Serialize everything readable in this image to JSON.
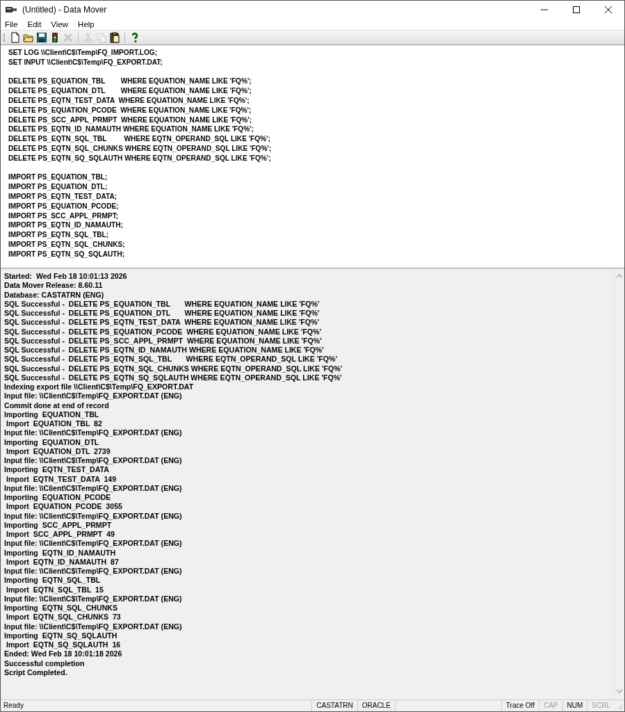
{
  "window": {
    "title": "(Untitled) - Data Mover"
  },
  "menu": [
    "File",
    "Edit",
    "View",
    "Help"
  ],
  "toolbar": [
    {
      "kind": "new",
      "disabled": false
    },
    {
      "kind": "open",
      "disabled": false
    },
    {
      "kind": "save",
      "disabled": false
    },
    {
      "kind": "run",
      "disabled": false
    },
    {
      "kind": "cancel",
      "disabled": true
    },
    {
      "kind": "sep"
    },
    {
      "kind": "cut",
      "disabled": true
    },
    {
      "kind": "copy",
      "disabled": true
    },
    {
      "kind": "paste",
      "disabled": false
    },
    {
      "kind": "sep"
    },
    {
      "kind": "help",
      "disabled": false
    }
  ],
  "editor": {
    "blocks": [
      [
        "SET LOG \\\\Client\\C$\\Temp\\FQ_IMPORT.LOG;",
        "SET INPUT \\\\Client\\C$\\Temp\\FQ_EXPORT.DAT;"
      ],
      [
        "DELETE PS_EQUATION_TBL        WHERE EQUATION_NAME LIKE 'FQ%';",
        "DELETE PS_EQUATION_DTL        WHERE EQUATION_NAME LIKE 'FQ%';",
        "DELETE PS_EQTN_TEST_DATA  WHERE EQUATION_NAME LIKE 'FQ%';",
        "DELETE PS_EQUATION_PCODE  WHERE EQUATION_NAME LIKE 'FQ%';",
        "DELETE PS_SCC_APPL_PRMPT  WHERE EQUATION_NAME LIKE 'FQ%';",
        "DELETE PS_EQTN_ID_NAMAUTH WHERE EQUATION_NAME LIKE 'FQ%';",
        "DELETE PS_EQTN_SQL_TBL         WHERE EQTN_OPERAND_SQL LIKE 'FQ%';",
        "DELETE PS_EQTN_SQL_CHUNKS WHERE EQTN_OPERAND_SQL LIKE 'FQ%';",
        "DELETE PS_EQTN_SQ_SQLAUTH WHERE EQTN_OPERAND_SQL LIKE 'FQ%';"
      ],
      [
        "IMPORT PS_EQUATION_TBL;",
        "IMPORT PS_EQUATION_DTL;",
        "IMPORT PS_EQTN_TEST_DATA;",
        "IMPORT PS_EQUATION_PCODE;",
        "IMPORT PS_SCC_APPL_PRMPT;",
        "IMPORT PS_EQTN_ID_NAMAUTH;",
        "IMPORT PS_EQTN_SQL_TBL;",
        "IMPORT PS_EQTN_SQL_CHUNKS;",
        "IMPORT PS_EQTN_SQ_SQLAUTH;"
      ]
    ]
  },
  "log": [
    "Started:  Wed Feb 18 10:01:13 2026",
    "Data Mover Release: 8.60.11",
    "Database: CASTATRN (ENG)",
    "SQL Successful -  DELETE PS_EQUATION_TBL       WHERE EQUATION_NAME LIKE 'FQ%'",
    "SQL Successful -  DELETE PS_EQUATION_DTL       WHERE EQUATION_NAME LIKE 'FQ%'",
    "SQL Successful -  DELETE PS_EQTN_TEST_DATA  WHERE EQUATION_NAME LIKE 'FQ%'",
    "SQL Successful -  DELETE PS_EQUATION_PCODE  WHERE EQUATION_NAME LIKE 'FQ%'",
    "SQL Successful -  DELETE PS_SCC_APPL_PRMPT  WHERE EQUATION_NAME LIKE 'FQ%'",
    "SQL Successful -  DELETE PS_EQTN_ID_NAMAUTH WHERE EQUATION_NAME LIKE 'FQ%'",
    "SQL Successful -  DELETE PS_EQTN_SQL_TBL       WHERE EQTN_OPERAND_SQL LIKE 'FQ%'",
    "SQL Successful -  DELETE PS_EQTN_SQL_CHUNKS WHERE EQTN_OPERAND_SQL LIKE 'FQ%'",
    "SQL Successful -  DELETE PS_EQTN_SQ_SQLAUTH WHERE EQTN_OPERAND_SQL LIKE 'FQ%'",
    "Indexing export file \\\\Client\\C$\\Temp\\FQ_EXPORT.DAT",
    "Input file: \\\\Client\\C$\\Temp\\FQ_EXPORT.DAT (ENG)",
    "Commit done at end of record",
    "Importing  EQUATION_TBL",
    " Import  EQUATION_TBL  82",
    "Input file: \\\\Client\\C$\\Temp\\FQ_EXPORT.DAT (ENG)",
    "Importing  EQUATION_DTL",
    " Import  EQUATION_DTL  2739",
    "Input file: \\\\Client\\C$\\Temp\\FQ_EXPORT.DAT (ENG)",
    "Importing  EQTN_TEST_DATA",
    " Import  EQTN_TEST_DATA  149",
    "Input file: \\\\Client\\C$\\Temp\\FQ_EXPORT.DAT (ENG)",
    "Importing  EQUATION_PCODE",
    " Import  EQUATION_PCODE  3055",
    "Input file: \\\\Client\\C$\\Temp\\FQ_EXPORT.DAT (ENG)",
    "Importing  SCC_APPL_PRMPT",
    " Import  SCC_APPL_PRMPT  49",
    "Input file: \\\\Client\\C$\\Temp\\FQ_EXPORT.DAT (ENG)",
    "Importing  EQTN_ID_NAMAUTH",
    " Import  EQTN_ID_NAMAUTH  87",
    "Input file: \\\\Client\\C$\\Temp\\FQ_EXPORT.DAT (ENG)",
    "Importing  EQTN_SQL_TBL",
    " Import  EQTN_SQL_TBL  15",
    "Input file: \\\\Client\\C$\\Temp\\FQ_EXPORT.DAT (ENG)",
    "Importing  EQTN_SQL_CHUNKS",
    " Import  EQTN_SQL_CHUNKS  73",
    "Input file: \\\\Client\\C$\\Temp\\FQ_EXPORT.DAT (ENG)",
    "Importing  EQTN_SQ_SQLAUTH",
    " Import  EQTN_SQ_SQLAUTH  16",
    "Ended: Wed Feb 18 10:01:18 2026",
    "Successful completion",
    "Script Completed."
  ],
  "status_bar": {
    "message": "Ready",
    "database": "CASTATRN",
    "platform": "ORACLE",
    "trace": "Trace Off",
    "indicators": [
      {
        "label": "CAP",
        "on": false
      },
      {
        "label": "NUM",
        "on": true
      },
      {
        "label": "SCRL",
        "on": false
      }
    ]
  }
}
